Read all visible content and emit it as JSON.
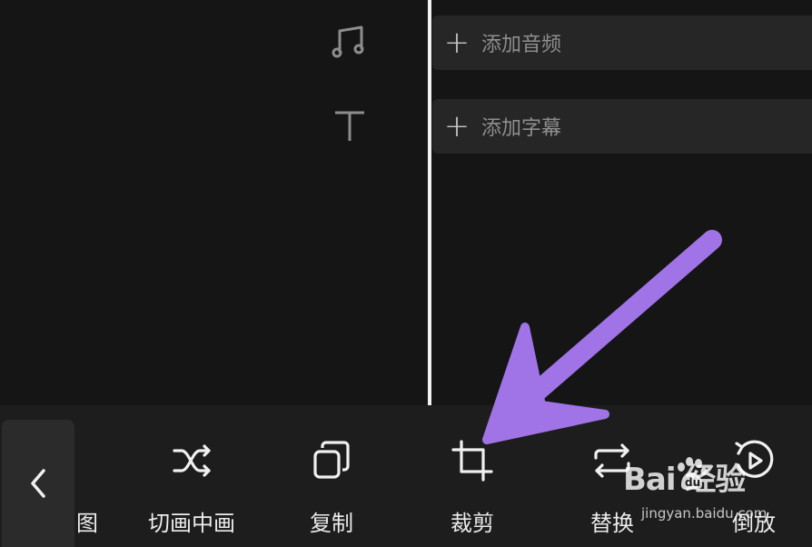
{
  "tracks": {
    "audio_label": "添加音频",
    "subtitle_label": "添加字幕"
  },
  "toolbar": {
    "partial_label": "图",
    "tools": [
      {
        "label": "切画中画",
        "icon": "shuffle-icon"
      },
      {
        "label": "复制",
        "icon": "copy-icon"
      },
      {
        "label": "裁剪",
        "icon": "crop-icon"
      },
      {
        "label": "替换",
        "icon": "replace-icon"
      },
      {
        "label": "倒放",
        "icon": "reverse-play-icon"
      }
    ]
  },
  "annotation": {
    "arrow_color": "#a074e6"
  },
  "watermark": {
    "logo": "Bai  经验",
    "subtitle": "jingyan.baidu.com"
  },
  "colors": {
    "background": "#151515",
    "toolbar": "#1d1d1d",
    "track_row": "#262626",
    "playhead": "#f2f2f2"
  }
}
